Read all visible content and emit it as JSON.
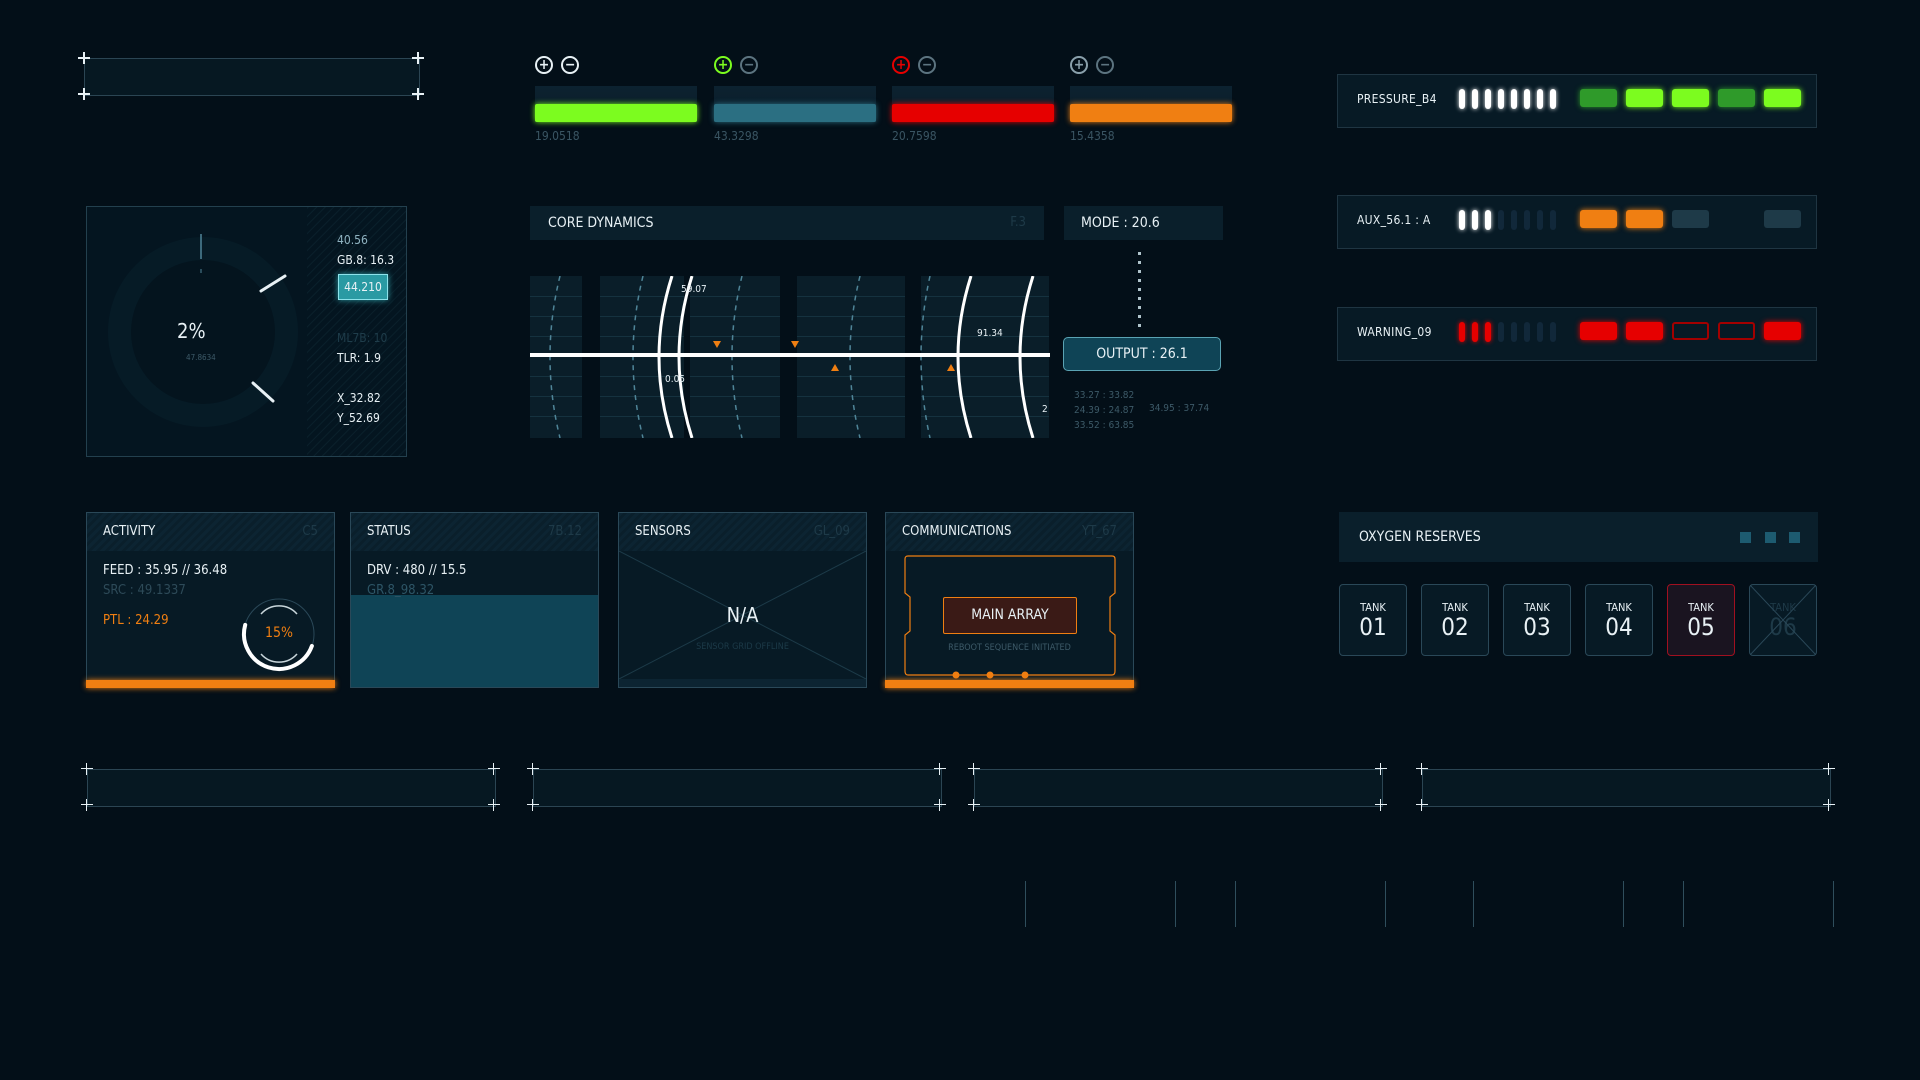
{
  "meters": [
    {
      "value_label": "19.0518",
      "fill_fraction": 1.0,
      "color": "#7cfc1f",
      "button_color": "#e8f1f5",
      "plus_icon": "plus-circle-icon",
      "minus_icon": "minus-circle-icon"
    },
    {
      "value_label": "43.3298",
      "fill_fraction": 1.0,
      "color": "#2b6f82",
      "button_color": "#7cfc1f",
      "plus_icon": "plus-circle-icon",
      "minus_icon": "minus-circle-icon"
    },
    {
      "value_label": "20.7598",
      "fill_fraction": 1.0,
      "color": "#e60000",
      "button_color": "#e60000",
      "plus_icon": "plus-circle-icon",
      "minus_icon": "minus-circle-icon"
    },
    {
      "value_label": "15.4358",
      "fill_fraction": 1.0,
      "color": "#f07f12",
      "button_color": "#8aa0ab",
      "plus_icon": "plus-circle-icon",
      "minus_icon": "minus-circle-icon"
    }
  ],
  "status_rows": [
    {
      "label": "PRESSURE_B4",
      "ticks_on": 8,
      "ticks_total": 8,
      "tick_color": "#ffffff",
      "blocks": [
        "dim-green",
        "green",
        "green",
        "dim-green",
        "green"
      ]
    },
    {
      "label": "AUX_56.1 : A",
      "ticks_on": 3,
      "ticks_total": 8,
      "tick_color": "#ffffff",
      "blocks": [
        "orange",
        "orange",
        "off",
        "none",
        "off"
      ]
    },
    {
      "label": "WARNING_09",
      "ticks_on": 3,
      "ticks_total": 8,
      "tick_color": "#e60000",
      "blocks": [
        "red",
        "red",
        "outline-red",
        "outline-red",
        "red"
      ]
    }
  ],
  "block_colors": {
    "green": "#7cfc1f",
    "dim-green": "#2f9a2a",
    "orange": "#f07f12",
    "off": "#1e3a48",
    "red": "#e60000"
  },
  "gauge": {
    "percent": "2%",
    "sub": "47.8634",
    "readouts": {
      "r1": "40.56",
      "r2": "GB.8: 16.3",
      "highlight": "44.210",
      "r3": "ML7B: 10",
      "r4": "TLR: 1.9",
      "x": "X_32.82",
      "y": "Y_52.69"
    }
  },
  "core_dynamics": {
    "title": "CORE DYNAMICS",
    "code": "F.3",
    "mode": "MODE : 20.6",
    "output": "OUTPUT : 26.1",
    "labels": {
      "a": "59.07",
      "b": "0.05",
      "c": "91.34",
      "d": "2"
    },
    "readouts": [
      "33.27 : 33.82",
      "24.39 : 24.87",
      "34.95 : 37.74",
      "33.52 : 63.85"
    ]
  },
  "panels": {
    "activity": {
      "title": "ACTIVITY",
      "code": "C5",
      "feed": "FEED : 35.95 // 36.48",
      "src": "SRC : 49.1337",
      "ptl": "PTL : 24.29",
      "ring_percent": "15%",
      "ring_fraction": 0.15
    },
    "status": {
      "title": "STATUS",
      "code": "7B.12",
      "drv": "DRV : 480 // 15.5",
      "gr": "GR.8_98.32"
    },
    "sensors": {
      "title": "SENSORS",
      "code": "GL_09",
      "value": "N/A",
      "sub": "SENSOR GRID OFFLINE"
    },
    "communications": {
      "title": "COMMUNICATIONS",
      "code": "YT_67",
      "button": "MAIN ARRAY",
      "sub": "REBOOT SEQUENCE INITIATED"
    }
  },
  "oxygen": {
    "title": "OXYGEN RESERVES",
    "tanks": [
      {
        "label": "TANK",
        "num": "01",
        "state": "normal"
      },
      {
        "label": "TANK",
        "num": "02",
        "state": "normal"
      },
      {
        "label": "TANK",
        "num": "03",
        "state": "normal"
      },
      {
        "label": "TANK",
        "num": "04",
        "state": "normal"
      },
      {
        "label": "TANK",
        "num": "05",
        "state": "alert"
      },
      {
        "label": "TANK",
        "num": "06",
        "state": "offline"
      }
    ]
  }
}
